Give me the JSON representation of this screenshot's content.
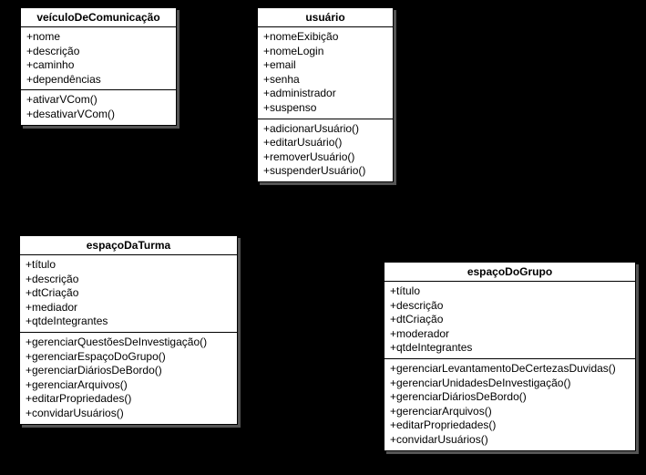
{
  "classes": {
    "veiculo": {
      "name": "veículoDeComunicação",
      "attrs": [
        "+nome",
        "+descrição",
        "+caminho",
        "+dependências"
      ],
      "ops": [
        "+ativarVCom()",
        "+desativarVCom()"
      ]
    },
    "usuario": {
      "name": "usuário",
      "attrs": [
        "+nomeExibição",
        "+nomeLogin",
        "+email",
        "+senha",
        "+administrador",
        "+suspenso"
      ],
      "ops": [
        "+adicionarUsuário()",
        "+editarUsuário()",
        "+removerUsuário()",
        "+suspenderUsuário()"
      ]
    },
    "turma": {
      "name": "espaçoDaTurma",
      "attrs": [
        "+título",
        "+descrição",
        "+dtCriação",
        "+mediador",
        "+qtdeIntegrantes"
      ],
      "ops": [
        "+gerenciarQuestõesDeInvestigação()",
        "+gerenciarEspaçoDoGrupo()",
        "+gerenciarDiáriosDeBordo()",
        "+gerenciarArquivos()",
        "+editarPropriedades()",
        "+convidarUsuários()"
      ]
    },
    "grupo": {
      "name": "espaçoDoGrupo",
      "attrs": [
        "+título",
        "+descrição",
        "+dtCriação",
        "+moderador",
        "+qtdeIntegrantes"
      ],
      "ops": [
        "+gerenciarLevantamentoDeCertezasDuvidas()",
        "+gerenciarUnidadesDeInvestigação()",
        "+gerenciarDiáriosDeBordo()",
        "+gerenciarArquivos()",
        "+editarPropriedades()",
        "+convidarUsuários()"
      ]
    }
  }
}
